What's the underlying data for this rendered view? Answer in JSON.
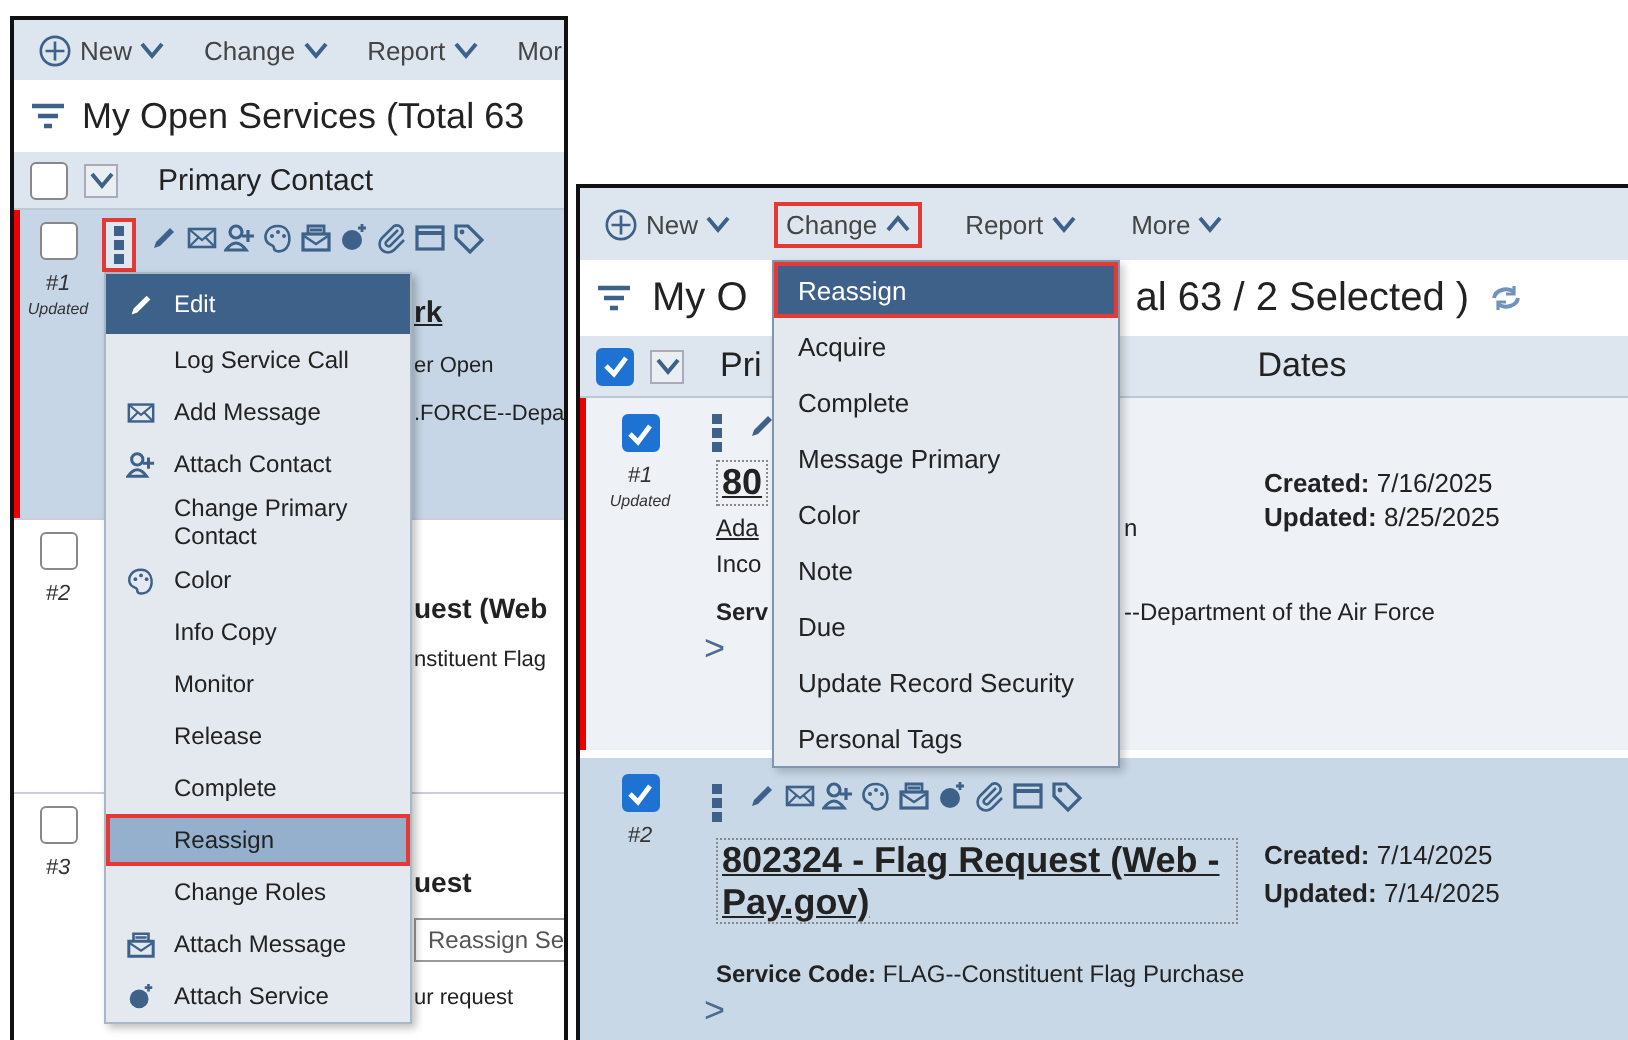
{
  "left_view": {
    "toolbar": [
      {
        "label": "New",
        "kind": "new",
        "expanded": false,
        "annotated": false
      },
      {
        "label": "Change",
        "kind": "menu",
        "expanded": false,
        "annotated": false
      },
      {
        "label": "Report",
        "kind": "menu",
        "expanded": false,
        "annotated": false
      },
      {
        "label": "Mor",
        "kind": "cut"
      }
    ],
    "title": "My Open Services (Total 63",
    "header": {
      "checked": false,
      "column": "Primary Contact"
    },
    "rows": [
      {
        "number": "#1",
        "badge": "Updated",
        "checked": false,
        "selected": true,
        "flagged": true,
        "kebab_annotated": true,
        "lines": [
          {
            "text": "rk",
            "kind": "title"
          },
          {
            "text": "er Open",
            "kind": "plain"
          },
          {
            "text": ".FORCE--Depa",
            "kind": "plain"
          }
        ]
      },
      {
        "number": "#2",
        "checked": false,
        "selected": false,
        "flagged": false,
        "lines": [
          {
            "text": "uest (Web",
            "kind": "heading"
          },
          {
            "text": "nstituent Flag",
            "kind": "plain"
          }
        ]
      },
      {
        "number": "#3",
        "checked": false,
        "selected": false,
        "flagged": false,
        "lines": [
          {
            "text": "uest",
            "kind": "heading"
          },
          {
            "text": "Reassign Se",
            "kind": "tooltip"
          },
          {
            "text": "ur request",
            "kind": "plain"
          }
        ]
      }
    ],
    "context_menu": [
      {
        "label": "Edit",
        "selected": true,
        "hovered": false,
        "annotated": false
      },
      {
        "label": "Log Service Call",
        "selected": false,
        "hovered": false,
        "annotated": false
      },
      {
        "label": "Add Message",
        "selected": false,
        "hovered": false,
        "annotated": false
      },
      {
        "label": "Attach Contact",
        "selected": false,
        "hovered": false,
        "annotated": false
      },
      {
        "label": "Change Primary Contact",
        "selected": false,
        "hovered": false,
        "annotated": false
      },
      {
        "label": "Color",
        "selected": false,
        "hovered": false,
        "annotated": false
      },
      {
        "label": "Info Copy",
        "selected": false,
        "hovered": false,
        "annotated": false
      },
      {
        "label": "Monitor",
        "selected": false,
        "hovered": false,
        "annotated": false
      },
      {
        "label": "Release",
        "selected": false,
        "hovered": false,
        "annotated": false
      },
      {
        "label": "Complete",
        "selected": false,
        "hovered": false,
        "annotated": false
      },
      {
        "label": "Reassign",
        "selected": false,
        "hovered": true,
        "annotated": true
      },
      {
        "label": "Change Roles",
        "selected": false,
        "hovered": false,
        "annotated": false
      },
      {
        "label": "Attach Message",
        "selected": false,
        "hovered": false,
        "annotated": false
      },
      {
        "label": "Attach Service",
        "selected": false,
        "hovered": false,
        "annotated": false
      }
    ]
  },
  "right_view": {
    "toolbar": [
      {
        "label": "New",
        "kind": "new",
        "expanded": false,
        "annotated": false
      },
      {
        "label": "Change",
        "kind": "menu",
        "expanded": true,
        "annotated": true
      },
      {
        "label": "Report",
        "kind": "menu",
        "expanded": false,
        "annotated": false
      },
      {
        "label": "More",
        "kind": "menu",
        "expanded": false,
        "annotated": false
      }
    ],
    "title_start": "My O",
    "title_end": "al 63 / 2 Selected )",
    "header": {
      "checked": true,
      "column_start": "Pri",
      "column_dates": "Dates"
    },
    "row_1": {
      "number": "#1",
      "badge": "Updated",
      "checked": true,
      "selected": false,
      "flagged": true,
      "title_start": "80",
      "contact_start": "Ada",
      "contact_end": "n",
      "line_3": "Inco",
      "service_label": "Serv",
      "service_end": "--Department of the Air Force",
      "created_label": "Created:",
      "created": "7/16/2025",
      "updated_label": "Updated:",
      "updated": "8/25/2025",
      "expand": ">"
    },
    "row_2": {
      "number": "#2",
      "checked": true,
      "selected": true,
      "flagged": false,
      "title": "802324 - Flag Request (Web - Pay.gov)",
      "created_label": "Created:",
      "created": "7/14/2025",
      "updated_label": "Updated:",
      "updated": "7/14/2025",
      "service_label": "Service Code:",
      "service": "FLAG--Constituent Flag Purchase",
      "expand": ">"
    },
    "change_menu": [
      {
        "label": "Reassign",
        "selected": true,
        "annotated": true
      },
      {
        "label": "Acquire",
        "selected": false,
        "annotated": false
      },
      {
        "label": "Complete",
        "selected": false,
        "annotated": false
      },
      {
        "label": "Message Primary",
        "selected": false,
        "annotated": false
      },
      {
        "label": "Color",
        "selected": false,
        "annotated": false
      },
      {
        "label": "Note",
        "selected": false,
        "annotated": false
      },
      {
        "label": "Due",
        "selected": false,
        "annotated": false
      },
      {
        "label": "Update Record Security",
        "selected": false,
        "annotated": false
      },
      {
        "label": "Personal Tags",
        "selected": false,
        "annotated": false
      }
    ]
  }
}
